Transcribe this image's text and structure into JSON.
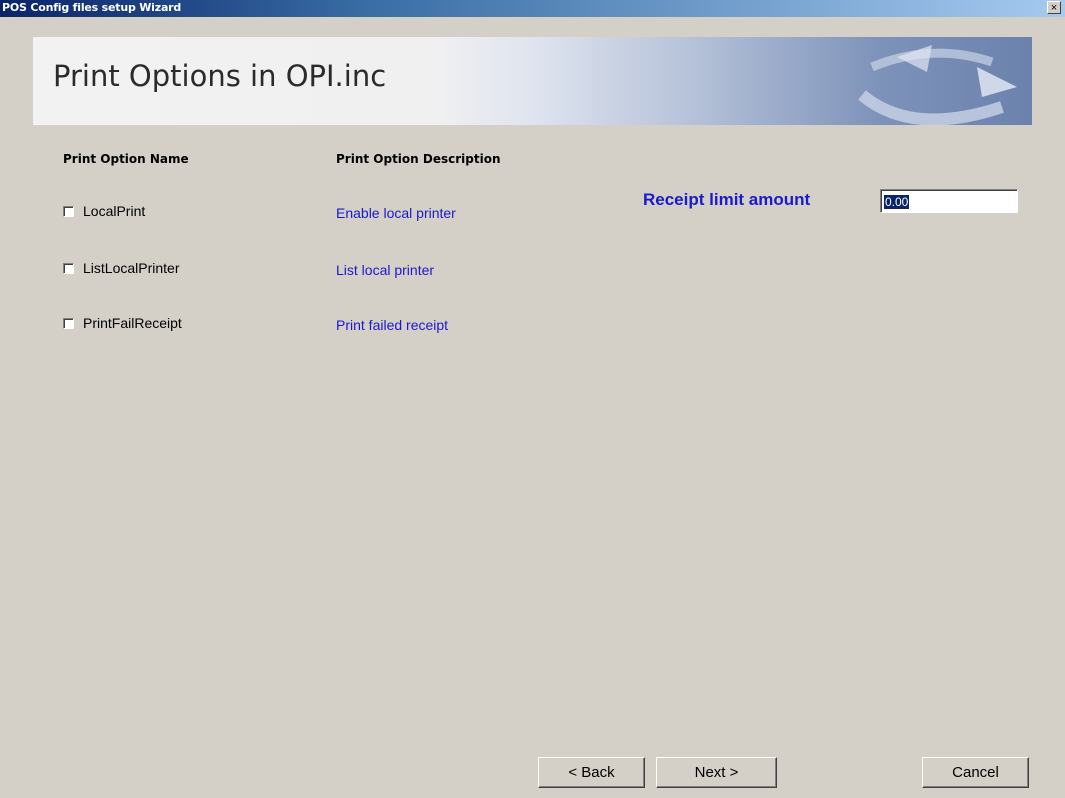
{
  "window": {
    "title": "POS Config files setup Wizard",
    "close_glyph": "×"
  },
  "banner": {
    "title": "Print Options in OPI.inc",
    "logo_icon": "circular-arrow-icon"
  },
  "headers": {
    "name": "Print Option Name",
    "description": "Print Option Description"
  },
  "options": [
    {
      "label": "LocalPrint",
      "description": "Enable local printer",
      "checked": false
    },
    {
      "label": "ListLocalPrinter",
      "description": "List local printer",
      "checked": false
    },
    {
      "label": "PrintFailReceipt",
      "description": "Print failed receipt",
      "checked": false
    }
  ],
  "receipt_limit": {
    "label": "Receipt limit amount",
    "value": "0.00"
  },
  "buttons": {
    "back": "< Back",
    "next": "Next >",
    "cancel": "Cancel"
  },
  "colors": {
    "link_blue": "#1a1acc",
    "dialog_bg": "#d4d0c8",
    "title_bar": "#0a246a"
  }
}
